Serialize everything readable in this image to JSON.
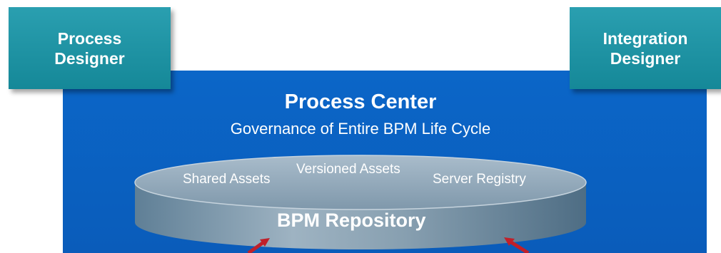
{
  "designers": {
    "process": "Process\nDesigner",
    "integration": "Integration\nDesigner"
  },
  "process_center": {
    "title": "Process Center",
    "subtitle": "Governance of Entire BPM Life Cycle"
  },
  "repository": {
    "title": "BPM Repository",
    "shared_assets": "Shared Assets",
    "versioned_assets": "Versioned Assets",
    "server_registry": "Server Registry"
  },
  "colors": {
    "designer_box": "#1b8fa0",
    "process_center": "#0a62c4",
    "arrow": "#c0202a"
  }
}
